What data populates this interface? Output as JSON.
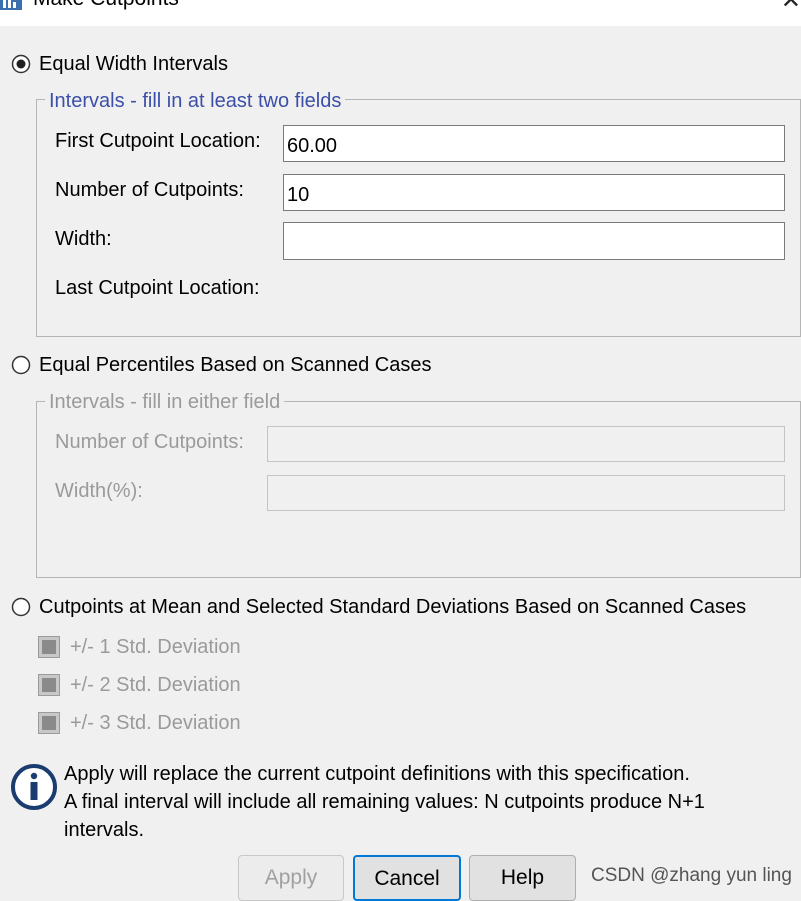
{
  "window": {
    "title": "Make Cutpoints",
    "close_glyph": "✕"
  },
  "equal_width": {
    "radio_label": "Equal Width Intervals",
    "selected": true,
    "group_legend": "Intervals - fill in at least two fields",
    "fields": [
      {
        "label": "First Cutpoint Location:",
        "value": "60.00"
      },
      {
        "label": "Number of Cutpoints:",
        "value": "10"
      },
      {
        "label": "Width:",
        "value": ""
      }
    ],
    "last_cutpoint_label": "Last Cutpoint Location:"
  },
  "equal_percentiles": {
    "radio_label": "Equal Percentiles Based on Scanned Cases",
    "selected": false,
    "group_legend": "Intervals - fill in either field",
    "fields": [
      {
        "label": "Number of Cutpoints:",
        "value": ""
      },
      {
        "label": "Width(%):",
        "value": ""
      }
    ]
  },
  "mean_sd": {
    "radio_label": "Cutpoints at Mean and Selected Standard Deviations Based on Scanned Cases",
    "selected": false,
    "options": [
      {
        "label": "+/- 1 Std. Deviation"
      },
      {
        "label": "+/- 2 Std. Deviation"
      },
      {
        "label": "+/- 3 Std. Deviation"
      }
    ]
  },
  "info": {
    "icon": "info-icon",
    "line1": "Apply will replace the current cutpoint definitions with this specification.",
    "line2": "A final interval will include all remaining values: N cutpoints produce N+1",
    "line3": "intervals."
  },
  "buttons": {
    "apply": "Apply",
    "cancel": "Cancel",
    "help": "Help"
  },
  "watermark": "CSDN @zhang yun ling",
  "colors": {
    "accent": "#0078d7",
    "legend_text": "#3c4fa8",
    "disabled_text": "#9a9a9a"
  }
}
